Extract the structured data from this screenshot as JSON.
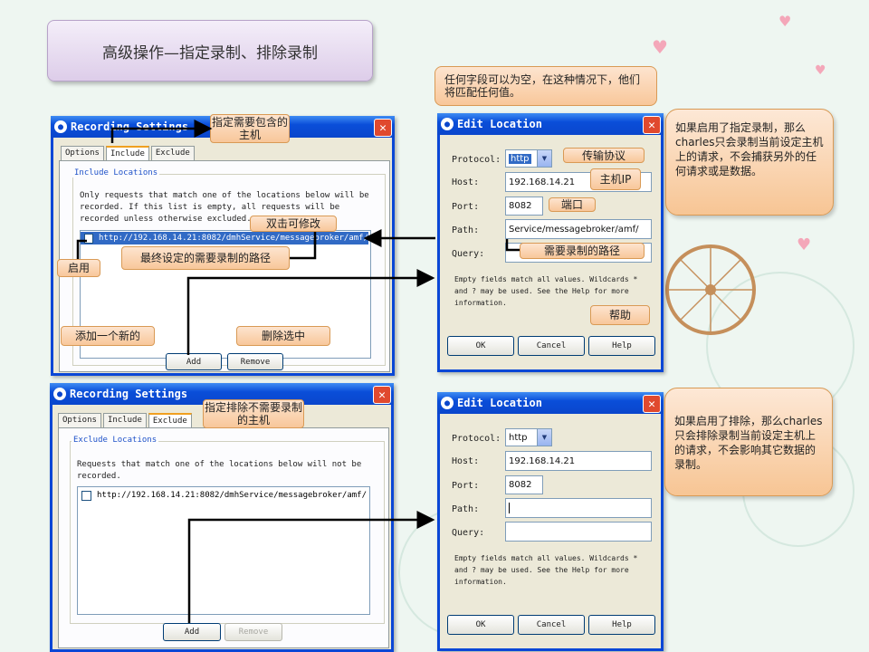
{
  "title": "高级操作—指定录制、排除录制",
  "top_note": "任何字段可以为空，在这种情况下，他们将匹配任何值。",
  "recording_include": {
    "window_title": "Recording Settings",
    "tabs": [
      "Options",
      "Include",
      "Exclude"
    ],
    "active_tab": "Include",
    "group_label": "Include Locations",
    "description": "Only requests that match one of the locations below will be recorded. If this list is empty, all requests will be recorded unless otherwise excluded.",
    "entry": "http://192.168.14.21:8082/dmhService/messagebroker/amf/",
    "add_label": "Add",
    "remove_label": "Remove"
  },
  "edit_include": {
    "window_title": "Edit Location",
    "protocol_label": "Protocol:",
    "protocol_value": "http",
    "host_label": "Host:",
    "host_value": "192.168.14.21",
    "port_label": "Port:",
    "port_value": "8082",
    "path_label": "Path:",
    "path_value": "Service/messagebroker/amf/",
    "query_label": "Query:",
    "query_value": "",
    "help_text": "Empty fields match all values. Wildcards * and ? may be used. See the Help for more information.",
    "ok_label": "OK",
    "cancel_label": "Cancel",
    "help_label": "Help"
  },
  "recording_exclude": {
    "window_title": "Recording Settings",
    "tabs": [
      "Options",
      "Include",
      "Exclude"
    ],
    "active_tab": "Exclude",
    "group_label": "Exclude Locations",
    "description": "Requests that match one of the locations below will not be recorded.",
    "entry": "http://192.168.14.21:8082/dmhService/messagebroker/amf/",
    "add_label": "Add",
    "remove_label": "Remove"
  },
  "edit_exclude": {
    "window_title": "Edit Location",
    "protocol_label": "Protocol:",
    "protocol_value": "http",
    "host_label": "Host:",
    "host_value": "192.168.14.21",
    "port_label": "Port:",
    "port_value": "8082",
    "path_label": "Path:",
    "path_value": "",
    "query_label": "Query:",
    "query_value": "",
    "help_text": "Empty fields match all values. Wildcards * and ? may be used. See the Help for more information.",
    "ok_label": "OK",
    "cancel_label": "Cancel",
    "help_label": "Help"
  },
  "callouts": {
    "include_host": "指定需要包含的主机",
    "double_click": "双击可修改",
    "enable": "启用",
    "final_path": "最终设定的需要录制的路径",
    "add_new": "添加一个新的",
    "delete_selected": "删除选中",
    "protocol": "传输协议",
    "host_ip": "主机IP",
    "port": "端口",
    "record_path": "需要录制的路径",
    "help": "帮助",
    "exclude_host": "指定排除不需要录制的主机",
    "include_explain": "如果启用了指定录制，那么charles只会录制当前设定主机上的请求，不会捕获另外的任何请求或是数据。",
    "exclude_explain": "如果启用了排除，那么charles只会排除录制当前设定主机上的请求，不会影响其它数据的录制。"
  },
  "colors": {
    "titlebar": "#0a4ed9",
    "callout": "#f8c79a",
    "selection": "#316ac5"
  }
}
